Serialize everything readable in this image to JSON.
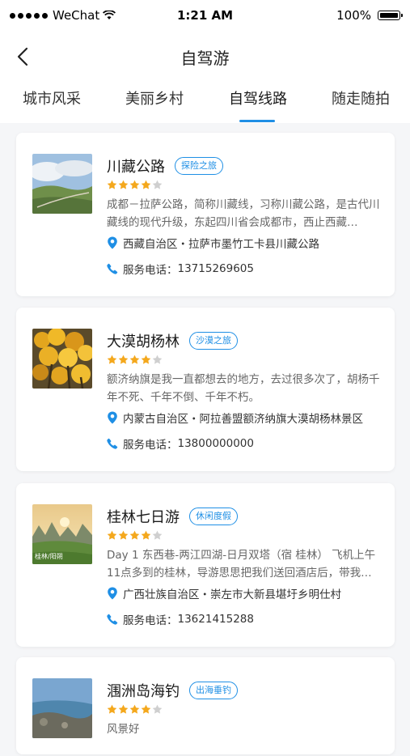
{
  "status": {
    "carrier": "WeChat",
    "time": "1:21 AM",
    "battery": "100%"
  },
  "nav": {
    "title": "自驾游"
  },
  "tabs": [
    {
      "label": "城市风采",
      "active": false
    },
    {
      "label": "美丽乡村",
      "active": false
    },
    {
      "label": "自驾线路",
      "active": true
    },
    {
      "label": "随走随拍",
      "active": false
    }
  ],
  "cards": [
    {
      "name": "川藏公路",
      "tag": "探险之旅",
      "rating": 4,
      "desc": "成都－拉萨公路，简称川藏线，习称川藏公路，是古代川藏线的现代升级，东起四川省会成都市，西止西藏…",
      "location": "西藏自治区・拉萨市墨竹工卡县川藏公路",
      "phone_label": "服务电话：",
      "phone": "13715269605"
    },
    {
      "name": "大漠胡杨林",
      "tag": "沙漠之旅",
      "rating": 4,
      "desc": "额济纳旗是我一直都想去的地方，去过很多次了，胡杨千年不死、千年不倒、千年不朽。",
      "location": "内蒙古自治区・阿拉善盟额济纳旗大漠胡杨林景区",
      "phone_label": "服务电话：",
      "phone": "13800000000"
    },
    {
      "name": "桂林七日游",
      "tag": "休闲度假",
      "rating": 4,
      "desc": "Day 1 东西巷-两江四湖-日月双塔（宿 桂林） 飞机上午11点多到的桂林，导游思思把我们送回酒店后，带我…",
      "location": "广西壮族自治区・崇左市大新县堪圩乡明仕村",
      "phone_label": "服务电话：",
      "phone": "13621415288",
      "thumb_caption": "桂林/阳朔"
    },
    {
      "name": "涠洲岛海钓",
      "tag": "出海垂钓",
      "rating": 4,
      "desc": "风景好"
    }
  ]
}
